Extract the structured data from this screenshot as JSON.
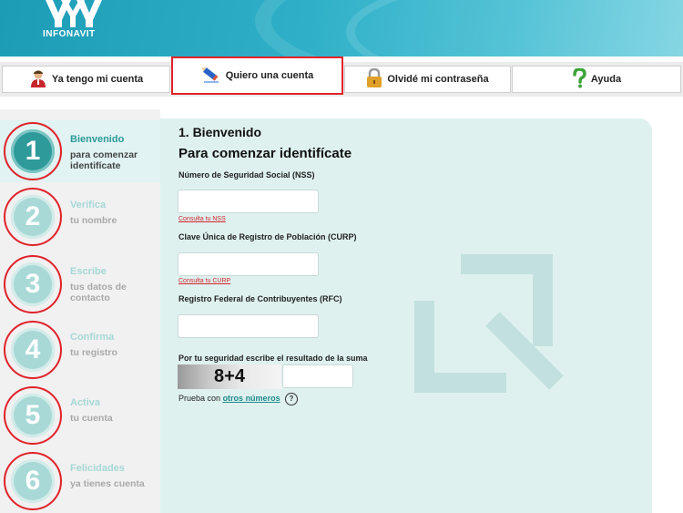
{
  "header": {
    "logo_text": "INFONAVIT"
  },
  "tabs": [
    {
      "label": "Ya tengo mi cuenta",
      "icon": "user-icon"
    },
    {
      "label": "Quiero una cuenta",
      "icon": "pencil-icon"
    },
    {
      "label": "Olvidé mi contraseña",
      "icon": "lock-icon"
    },
    {
      "label": "Ayuda",
      "icon": "question-icon"
    }
  ],
  "steps": [
    {
      "number": "1",
      "title": "Bienvenido",
      "subtitle": "para comenzar identifícate",
      "active": true
    },
    {
      "number": "2",
      "title": "Verifica",
      "subtitle": "tu nombre",
      "active": false
    },
    {
      "number": "3",
      "title": "Escribe",
      "subtitle": "tus datos de contacto",
      "active": false
    },
    {
      "number": "4",
      "title": "Confirma",
      "subtitle": "tu registro",
      "active": false
    },
    {
      "number": "5",
      "title": "Activa",
      "subtitle": "tu cuenta",
      "active": false
    },
    {
      "number": "6",
      "title": "Felicidades",
      "subtitle": "ya tienes cuenta",
      "active": false
    }
  ],
  "form": {
    "step_heading": "1. Bienvenido",
    "heading": "Para comenzar identifícate",
    "nss_label": "Número de Seguridad Social (NSS)",
    "nss_value": "",
    "nss_link": "Consulta tu NSS",
    "curp_label": "Clave Única de Registro de Población (CURP)",
    "curp_value": "",
    "curp_link": "Consulta tu CURP",
    "rfc_label": "Registro Federal de Contribuyentes (RFC)",
    "rfc_value": "",
    "captcha_label": "Por tu seguridad escribe el resultado de la suma",
    "captcha_text": "8+4",
    "captcha_value": "",
    "retry_prefix": "Prueba con",
    "retry_link": "otros números",
    "help_symbol": "?"
  },
  "colors": {
    "accent": "#2e9a9a",
    "highlight": "#e0222a",
    "panel": "#dff1ef"
  }
}
